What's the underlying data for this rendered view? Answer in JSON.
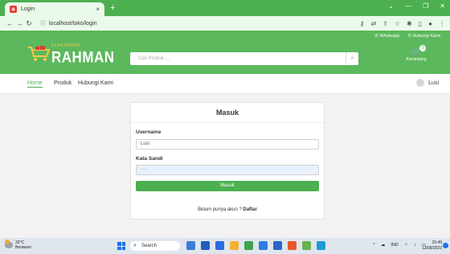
{
  "browser": {
    "tab_title": "Login",
    "tab_close": "×",
    "new_tab": "+",
    "url": "localhost/toko/login"
  },
  "header": {
    "whatsapp": "✆ Whatsapp",
    "hubungi": "✆ Hubungi Kami",
    "logo_small": "ELEKTRONIK",
    "logo_word": "RAHMAN",
    "search_placeholder": "Cari Produk ....",
    "cart_label": "Keranjang",
    "cart_count": "0"
  },
  "nav": {
    "home": "Home",
    "produk": "Produk",
    "hubungi": "Hubungi Kami",
    "user": "Lusi"
  },
  "login": {
    "title": "Masuk",
    "username_label": "Username",
    "username_value": "Lusi",
    "password_label": "Kata Sandi",
    "password_value": "····",
    "submit": "Masuk",
    "register_text": "Belum punya akun ?",
    "register_link": "Daftar"
  },
  "taskbar": {
    "temp": "32°C",
    "weather": "Berawan",
    "search": "Search",
    "lang": "IND",
    "time": "15:49",
    "date": "13/08/2023"
  },
  "colors": {
    "brand_green": "#5cb85c",
    "button_green": "#4caf50"
  }
}
